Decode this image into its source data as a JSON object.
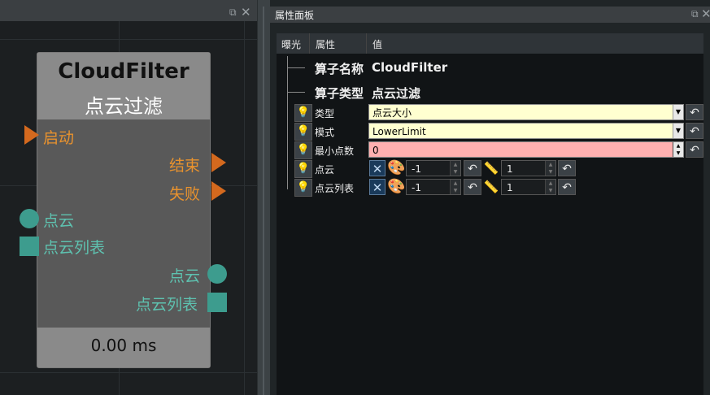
{
  "node": {
    "name": "CloudFilter",
    "type": "点云过滤",
    "time": "0.00 ms",
    "inputs": [
      "启动",
      "点云",
      "点云列表"
    ],
    "outputs": [
      "结束",
      "失败",
      "点云",
      "点云列表"
    ]
  },
  "panel": {
    "title": "属性面板",
    "columns": [
      "曝光",
      "属性",
      "值"
    ],
    "operator_name_label": "算子名称",
    "operator_name": "CloudFilter",
    "operator_type_label": "算子类型",
    "operator_type": "点云过滤",
    "rows": [
      {
        "label": "类型",
        "value": "点云大小"
      },
      {
        "label": "模式",
        "value": "LowerLimit"
      },
      {
        "label": "最小点数",
        "value": "0"
      },
      {
        "label": "点云",
        "left": "-1",
        "right": "1"
      },
      {
        "label": "点云列表",
        "left": "-1",
        "right": "1"
      }
    ]
  },
  "icons": {
    "bulb": "lightbulb-icon",
    "reset": "undo-arrow-icon",
    "palette": "palette-icon",
    "ruler": "ruler-icon",
    "visibility": "crossed-x-icon",
    "float": "float-window-icon",
    "close": "close-icon"
  },
  "colors": {
    "port_flow": "#d4691e",
    "port_data": "#3d9c8e",
    "combo_bg": "#ffffd0",
    "invalid_bg": "#ffb0b0"
  }
}
